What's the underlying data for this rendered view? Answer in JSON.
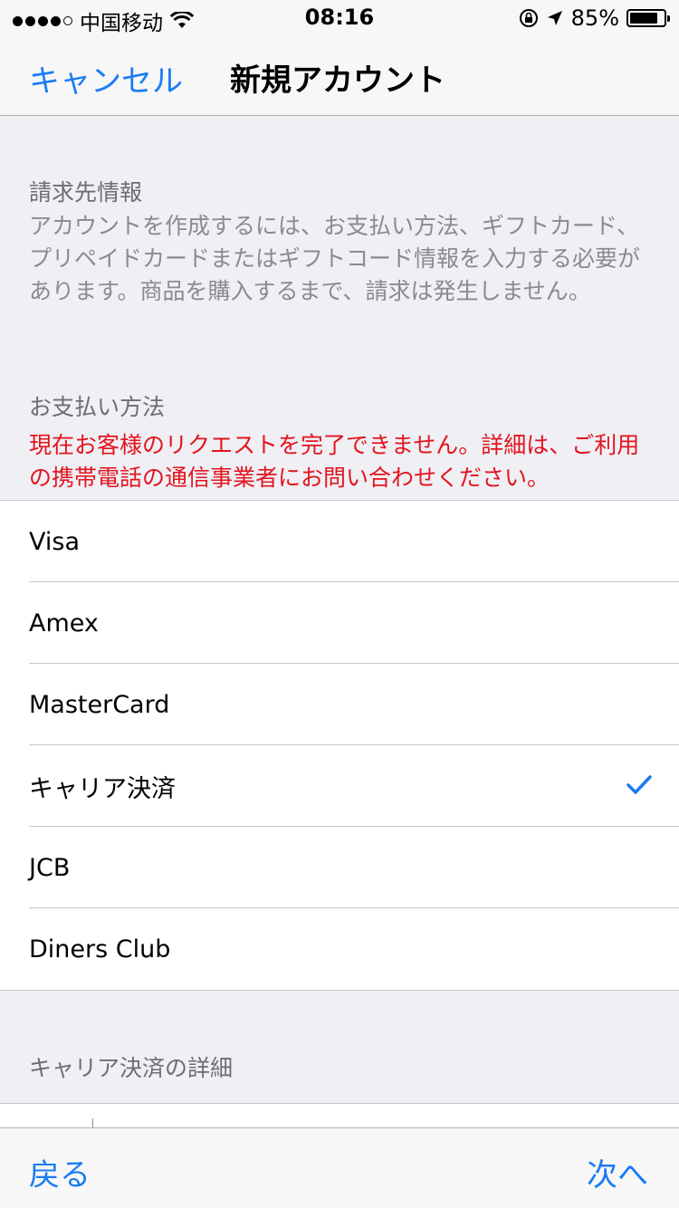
{
  "status_bar": {
    "carrier": "中国移动",
    "time": "08:16",
    "battery": "85%",
    "battery_level": 0.85
  },
  "nav": {
    "cancel": "キャンセル",
    "title": "新規アカウント"
  },
  "billing": {
    "header": "請求先情報",
    "description": "アカウントを作成するには、お支払い方法、ギフトカード、プリペイドカードまたはギフトコード情報を入力する必要があります。商品を購入するまで、請求は発生しません。"
  },
  "payment": {
    "header": "お支払い方法",
    "error": "現在お客様のリクエストを完了できません。詳細は、ご利用の携帯電話の通信事業者にお問い合わせください。",
    "options": [
      {
        "label": "Visa",
        "selected": false
      },
      {
        "label": "Amex",
        "selected": false
      },
      {
        "label": "MasterCard",
        "selected": false
      },
      {
        "label": "キャリア決済",
        "selected": true
      },
      {
        "label": "JCB",
        "selected": false
      },
      {
        "label": "Diners Club",
        "selected": false
      }
    ]
  },
  "carrier_details": {
    "header": "キャリア決済の詳細"
  },
  "toolbar": {
    "back": "戻る",
    "next": "次へ"
  },
  "colors": {
    "accent": "#1a7cf5",
    "error": "#e3141e",
    "background": "#efeff4"
  }
}
